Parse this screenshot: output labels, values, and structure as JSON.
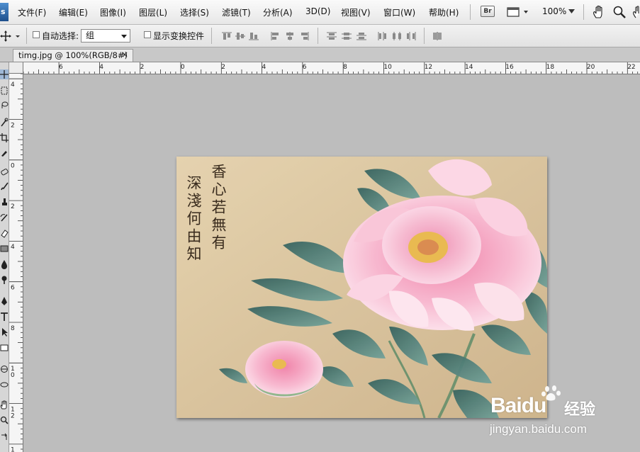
{
  "app": {
    "logo_letter": "s"
  },
  "menu": {
    "items": [
      "文件(F)",
      "编辑(E)",
      "图像(I)",
      "图层(L)",
      "选择(S)",
      "滤镜(T)",
      "分析(A)",
      "3D(D)",
      "视图(V)",
      "窗口(W)",
      "帮助(H)"
    ],
    "bridge_label": "Br",
    "zoom_value": "100%"
  },
  "options": {
    "auto_select_label": "自动选择:",
    "auto_select_value": "组",
    "show_transform_label": "显示变换控件"
  },
  "document": {
    "tab_title": "timg.jpg @ 100%(RGB/8#)",
    "close_glyph": "×"
  },
  "rulers": {
    "h_labels": [
      "6",
      "4",
      "2",
      "0",
      "2",
      "4",
      "6",
      "8",
      "10",
      "12",
      "14",
      "16",
      "18",
      "20",
      "22"
    ],
    "v_labels": [
      "4",
      "2",
      "0",
      "2",
      "4",
      "6",
      "8",
      "1 0",
      "1 2",
      "1"
    ]
  },
  "image": {
    "poem_columns": [
      "香心若無有",
      "深淺何由知"
    ],
    "watermark_brand": "Baidu",
    "watermark_cn": "经验",
    "watermark_url": "jingyan.baidu.com"
  },
  "colors": {
    "accent": "#1d4f8c",
    "peony": "#f5a9c6",
    "leaf": "#3e6e66"
  }
}
